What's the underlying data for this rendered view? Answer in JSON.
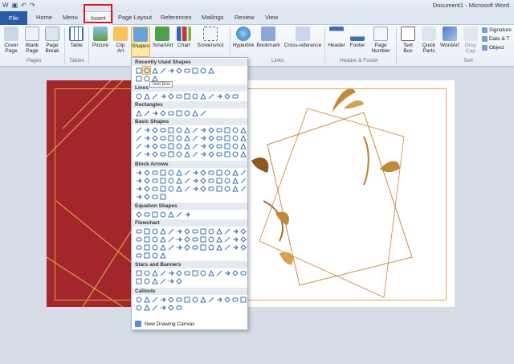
{
  "window": {
    "title": "Document1 - Microsoft Word"
  },
  "tabs": [
    {
      "label": "File"
    },
    {
      "label": "Home"
    },
    {
      "label": "Menu"
    },
    {
      "label": "Insert"
    },
    {
      "label": "Page Layout"
    },
    {
      "label": "References"
    },
    {
      "label": "Mailings"
    },
    {
      "label": "Review"
    },
    {
      "label": "View"
    }
  ],
  "ribbon": {
    "buttons": [
      {
        "label": "Cover Page"
      },
      {
        "label": "Blank Page"
      },
      {
        "label": "Page Break"
      },
      {
        "label": "Table"
      },
      {
        "label": "Picture"
      },
      {
        "label": "Clip Art"
      },
      {
        "label": "Shapes"
      },
      {
        "label": "SmartArt"
      },
      {
        "label": "Chart"
      },
      {
        "label": "Screenshot"
      },
      {
        "label": "Hyperlink"
      },
      {
        "label": "Bookmark"
      },
      {
        "label": "Cross-reference"
      },
      {
        "label": "Header"
      },
      {
        "label": "Footer"
      },
      {
        "label": "Page Number"
      },
      {
        "label": "Text Box"
      },
      {
        "label": "Quick Parts"
      },
      {
        "label": "WordArt"
      },
      {
        "label": "Drop Cap"
      }
    ],
    "groups": [
      {
        "label": "Pages"
      },
      {
        "label": "Tables"
      },
      {
        "label": "Links"
      },
      {
        "label": "Header & Footer"
      },
      {
        "label": "Text"
      }
    ],
    "small_buttons": [
      {
        "label": "Signature"
      },
      {
        "label": "Date & T"
      },
      {
        "label": "Object"
      }
    ]
  },
  "shapes_menu": {
    "sections": [
      {
        "label": "Recently Used Shapes"
      },
      {
        "label": "Lines"
      },
      {
        "label": "Rectangles"
      },
      {
        "label": "Basic Shapes"
      },
      {
        "label": "Block Arrows"
      },
      {
        "label": "Equation Shapes"
      },
      {
        "label": "Flowchart"
      },
      {
        "label": "Stars and Banners"
      },
      {
        "label": "Callouts"
      }
    ],
    "tooltip": "Text Box",
    "footer_item": "New Drawing Canvas"
  },
  "colors": {
    "accent": "#2a5aa8",
    "highlight": "#e0161b",
    "card_red": "#a2262a",
    "gold": "#d9a14a"
  }
}
